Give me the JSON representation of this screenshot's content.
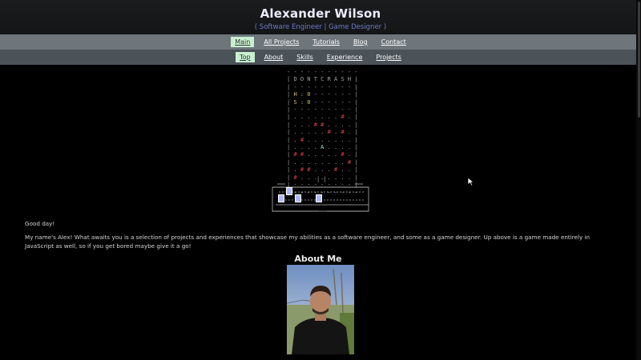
{
  "header": {
    "title": "Alexander Wilson",
    "subtitle": "( Software Engineer | Game Designer )"
  },
  "nav_main": {
    "items": [
      {
        "label": "Main",
        "active": true
      },
      {
        "label": "All Projects",
        "active": false
      },
      {
        "label": "Tutorials",
        "active": false
      },
      {
        "label": "Blog",
        "active": false
      },
      {
        "label": "Contact",
        "active": false
      }
    ]
  },
  "nav_sub": {
    "items": [
      {
        "label": "Top",
        "active": true
      },
      {
        "label": "About",
        "active": false
      },
      {
        "label": "Skills",
        "active": false
      },
      {
        "label": "Experience",
        "active": false
      },
      {
        "label": "Projects",
        "active": false
      }
    ]
  },
  "game": {
    "title_row": "D O N T C R A S H",
    "hi_row": "H : 0",
    "score_row": "S : 0",
    "pipes": "| |"
  },
  "content": {
    "greeting": "Good day!",
    "intro": "My name's Alex! What awaits you is a selection of projects and experiences that showcase my abilities as a software engineer, and some as a game designer. Up above is a game made entirely in JavaScript as well, so if you get bored maybe give it a go!",
    "about_heading": "About Me"
  },
  "colors": {
    "accent_active": "#c8f0d0",
    "nav_main_bg": "#6e767c",
    "nav_sub_bg": "#4b5258",
    "subtitle": "#6d7cc8"
  }
}
